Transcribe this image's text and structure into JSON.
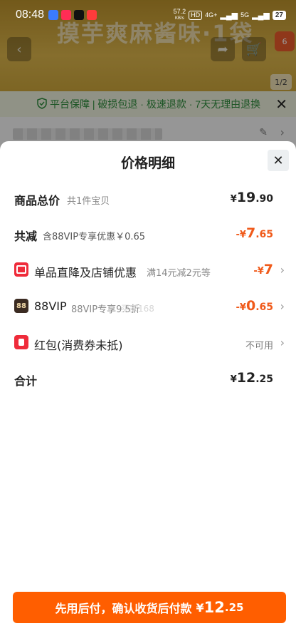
{
  "status_bar": {
    "time": "08:48",
    "net_speed": "57.2",
    "net_unit": "KB/s",
    "hd": "HD",
    "signal1": "4G+",
    "signal2": "5G",
    "battery": "27"
  },
  "background": {
    "product_title": "摸芋爽麻酱味·1袋",
    "cart_badge": "6",
    "image_counter": "1/2",
    "guarantee_text": "平台保障 | 破损包退 · 极速退款 · 7天无理由退换"
  },
  "sheet": {
    "title": "价格明细",
    "rows": {
      "subtotal": {
        "label": "商品总价",
        "sub": "共1件宝贝",
        "currency": "¥",
        "int": "19",
        "dec": ".90"
      },
      "discount": {
        "label": "共减",
        "sub": "含88VIP专享优惠￥0.65",
        "prefix": "-¥",
        "int": "7",
        "dec": ".65"
      },
      "shop": {
        "label": "单品直降及店铺优惠",
        "sub": "满14元减2元等",
        "prefix": "-¥",
        "int": "7",
        "dec": ""
      },
      "vip": {
        "icon_text": "88",
        "label": "88VIP",
        "sub": "88VIP专享9.5折",
        "prefix": "-¥",
        "int": "0",
        "dec": ".65"
      },
      "redpack": {
        "label": "红包(消费券未抵)",
        "status": "不可用"
      },
      "total": {
        "label": "合计",
        "currency": "¥",
        "int": "12",
        "dec": ".25"
      }
    },
    "watermark": "买家168"
  },
  "cta": {
    "text": "先用后付，确认收货后付款",
    "currency": "¥",
    "int": "12",
    "dec": ".25"
  },
  "colors": {
    "accent": "#ff5e00",
    "discount_red": "#f05a1a",
    "guarantee_green": "#2e8a3c"
  }
}
